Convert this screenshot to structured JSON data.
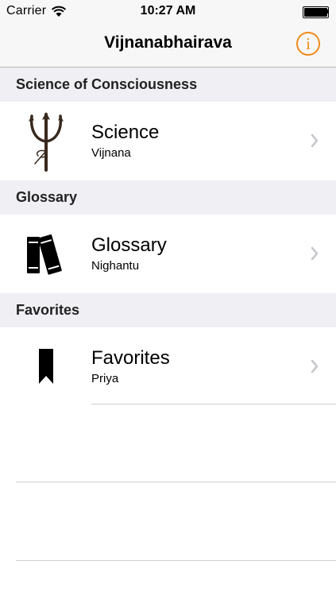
{
  "status_bar": {
    "carrier": "Carrier",
    "time": "10:27 AM",
    "icons": [
      "wifi-icon",
      "battery-icon"
    ]
  },
  "nav": {
    "title": "Vijnanabhairava",
    "info_icon": "i",
    "accent_color": "#ef8a1a"
  },
  "sections": [
    {
      "header": "Science of Consciousness",
      "item": {
        "title": "Science",
        "subtitle": "Vijnana",
        "icon": "trident-icon"
      }
    },
    {
      "header": "Glossary",
      "item": {
        "title": "Glossary",
        "subtitle": "Nighantu",
        "icon": "books-icon"
      }
    },
    {
      "header": "Favorites",
      "item": {
        "title": "Favorites",
        "subtitle": "Priya",
        "icon": "bookmark-icon"
      }
    }
  ]
}
